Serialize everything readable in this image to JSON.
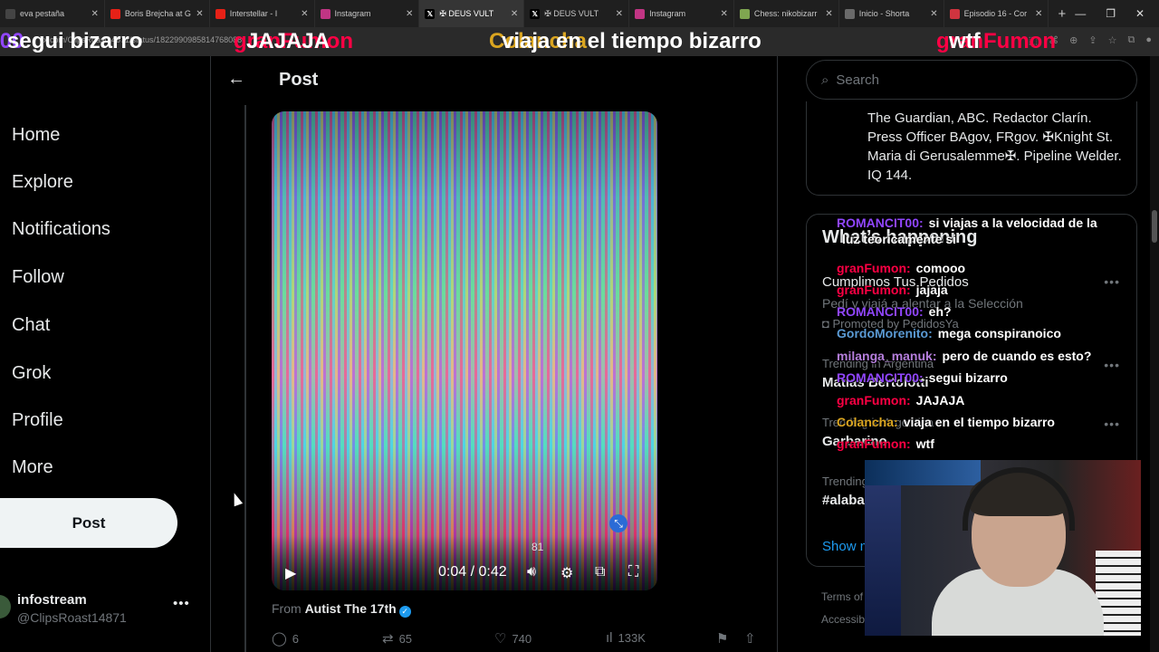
{
  "browser": {
    "tabs": [
      {
        "title": "eva pestaña",
        "icon": "blank",
        "color": "#444444"
      },
      {
        "title": "Boris Brejcha at G",
        "icon": "youtube-icon",
        "color": "#e62117"
      },
      {
        "title": "Interstellar - I",
        "icon": "youtube-icon",
        "color": "#e62117"
      },
      {
        "title": "Instagram",
        "icon": "instagram-icon",
        "color": "#c13584"
      },
      {
        "title": "✠ DEUS VULT",
        "icon": "x-icon",
        "color": "#000000"
      },
      {
        "title": "✠ DEUS VULT",
        "icon": "x-icon",
        "color": "#000000"
      },
      {
        "title": "Instagram",
        "icon": "instagram-icon",
        "color": "#c13584"
      },
      {
        "title": "Chess: nikobizarr",
        "icon": "chess-icon",
        "color": "#7fa650"
      },
      {
        "title": "Inicio - Shorta",
        "icon": "page-icon",
        "color": "#6a6a6a"
      },
      {
        "title": "Episodio 16 - Cor",
        "icon": "r-icon",
        "color": "#d0343f"
      }
    ],
    "url": "x.com/ClipsRoast14871/status/1822990985814768088"
  },
  "ticker": [
    {
      "user": "'00",
      "text": "segui bizarro",
      "color": "#9146ff"
    },
    {
      "user": "granFumon",
      "text": "JAJAJA",
      "color": "#ff0044"
    },
    {
      "user": "Colancha",
      "text": "viaja en el tiempo bizarro",
      "color": "#daa520"
    },
    {
      "user": "granFumon",
      "text": "wtf",
      "color": "#ff0044"
    }
  ],
  "nav": {
    "items": [
      "Home",
      "Explore",
      "Notifications",
      "Follow",
      "Chat",
      "Grok",
      "Profile",
      "More"
    ],
    "post_button": "Post"
  },
  "account": {
    "name": "infostream",
    "handle": "@ClipsRoast14871"
  },
  "main": {
    "title": "Post",
    "video": {
      "time": "0:04 / 0:42",
      "volume": "81",
      "progress": 0.095
    },
    "from_label": "From",
    "from_author": "Autist The 17th",
    "stats": {
      "replies": "6",
      "reposts": "65",
      "likes": "740",
      "views": "133K"
    }
  },
  "right": {
    "search_placeholder": "Search",
    "bio": "The Guardian, ABC. Redactor Clarín. Press Officer BAgov, FRgov. ✠Knight St. Maria di Gerusalemme✠. Pipeline Welder. IQ 144.",
    "trends": {
      "heading": "What’s happening",
      "promo_title": "Cumplimos Tus Pedidos",
      "promo_sub": "Pedí y viajá a alentar a la Selección",
      "promo_by": "Promoted by PedidosYa",
      "t1_context": "Trending in Argentina",
      "t1_name": "Matias Bertolotti",
      "t2_context": "Trending in Argentina",
      "t2_name": "Garbarino",
      "t3_context": "Trending",
      "t3_name": "#alaba",
      "show_more": "Show more"
    },
    "footer": {
      "terms": "Terms of",
      "access": "Accessib"
    }
  },
  "chat": [
    {
      "user": "ROMANCIT00:",
      "text": "si viajas a la velocidad de la",
      "color": "#9146ff"
    },
    {
      "user": "",
      "text": "luz teoricamente si",
      "color": "#9146ff"
    },
    {
      "user": "granFumon:",
      "text": "comooo",
      "color": "#ff0044"
    },
    {
      "user": "granFumon:",
      "text": "jajaja",
      "color": "#ff0044"
    },
    {
      "user": "ROMANCIT00:",
      "text": "eh?",
      "color": "#9146ff"
    },
    {
      "user": "GordoMorenito:",
      "text": "mega conspiranoico",
      "color": "#5b9bd5"
    },
    {
      "user": "milanga_manuk:",
      "text": "pero de cuando es esto?",
      "color": "#b57edc"
    },
    {
      "user": "ROMANCIT00:",
      "text": "segui bizarro",
      "color": "#9146ff"
    },
    {
      "user": "granFumon:",
      "text": "JAJAJA",
      "color": "#ff0044"
    },
    {
      "user": "Colancha:",
      "text": "viaja en el tiempo bizarro",
      "color": "#daa520"
    },
    {
      "user": "granFumon:",
      "text": "wtf",
      "color": "#ff0044"
    }
  ]
}
